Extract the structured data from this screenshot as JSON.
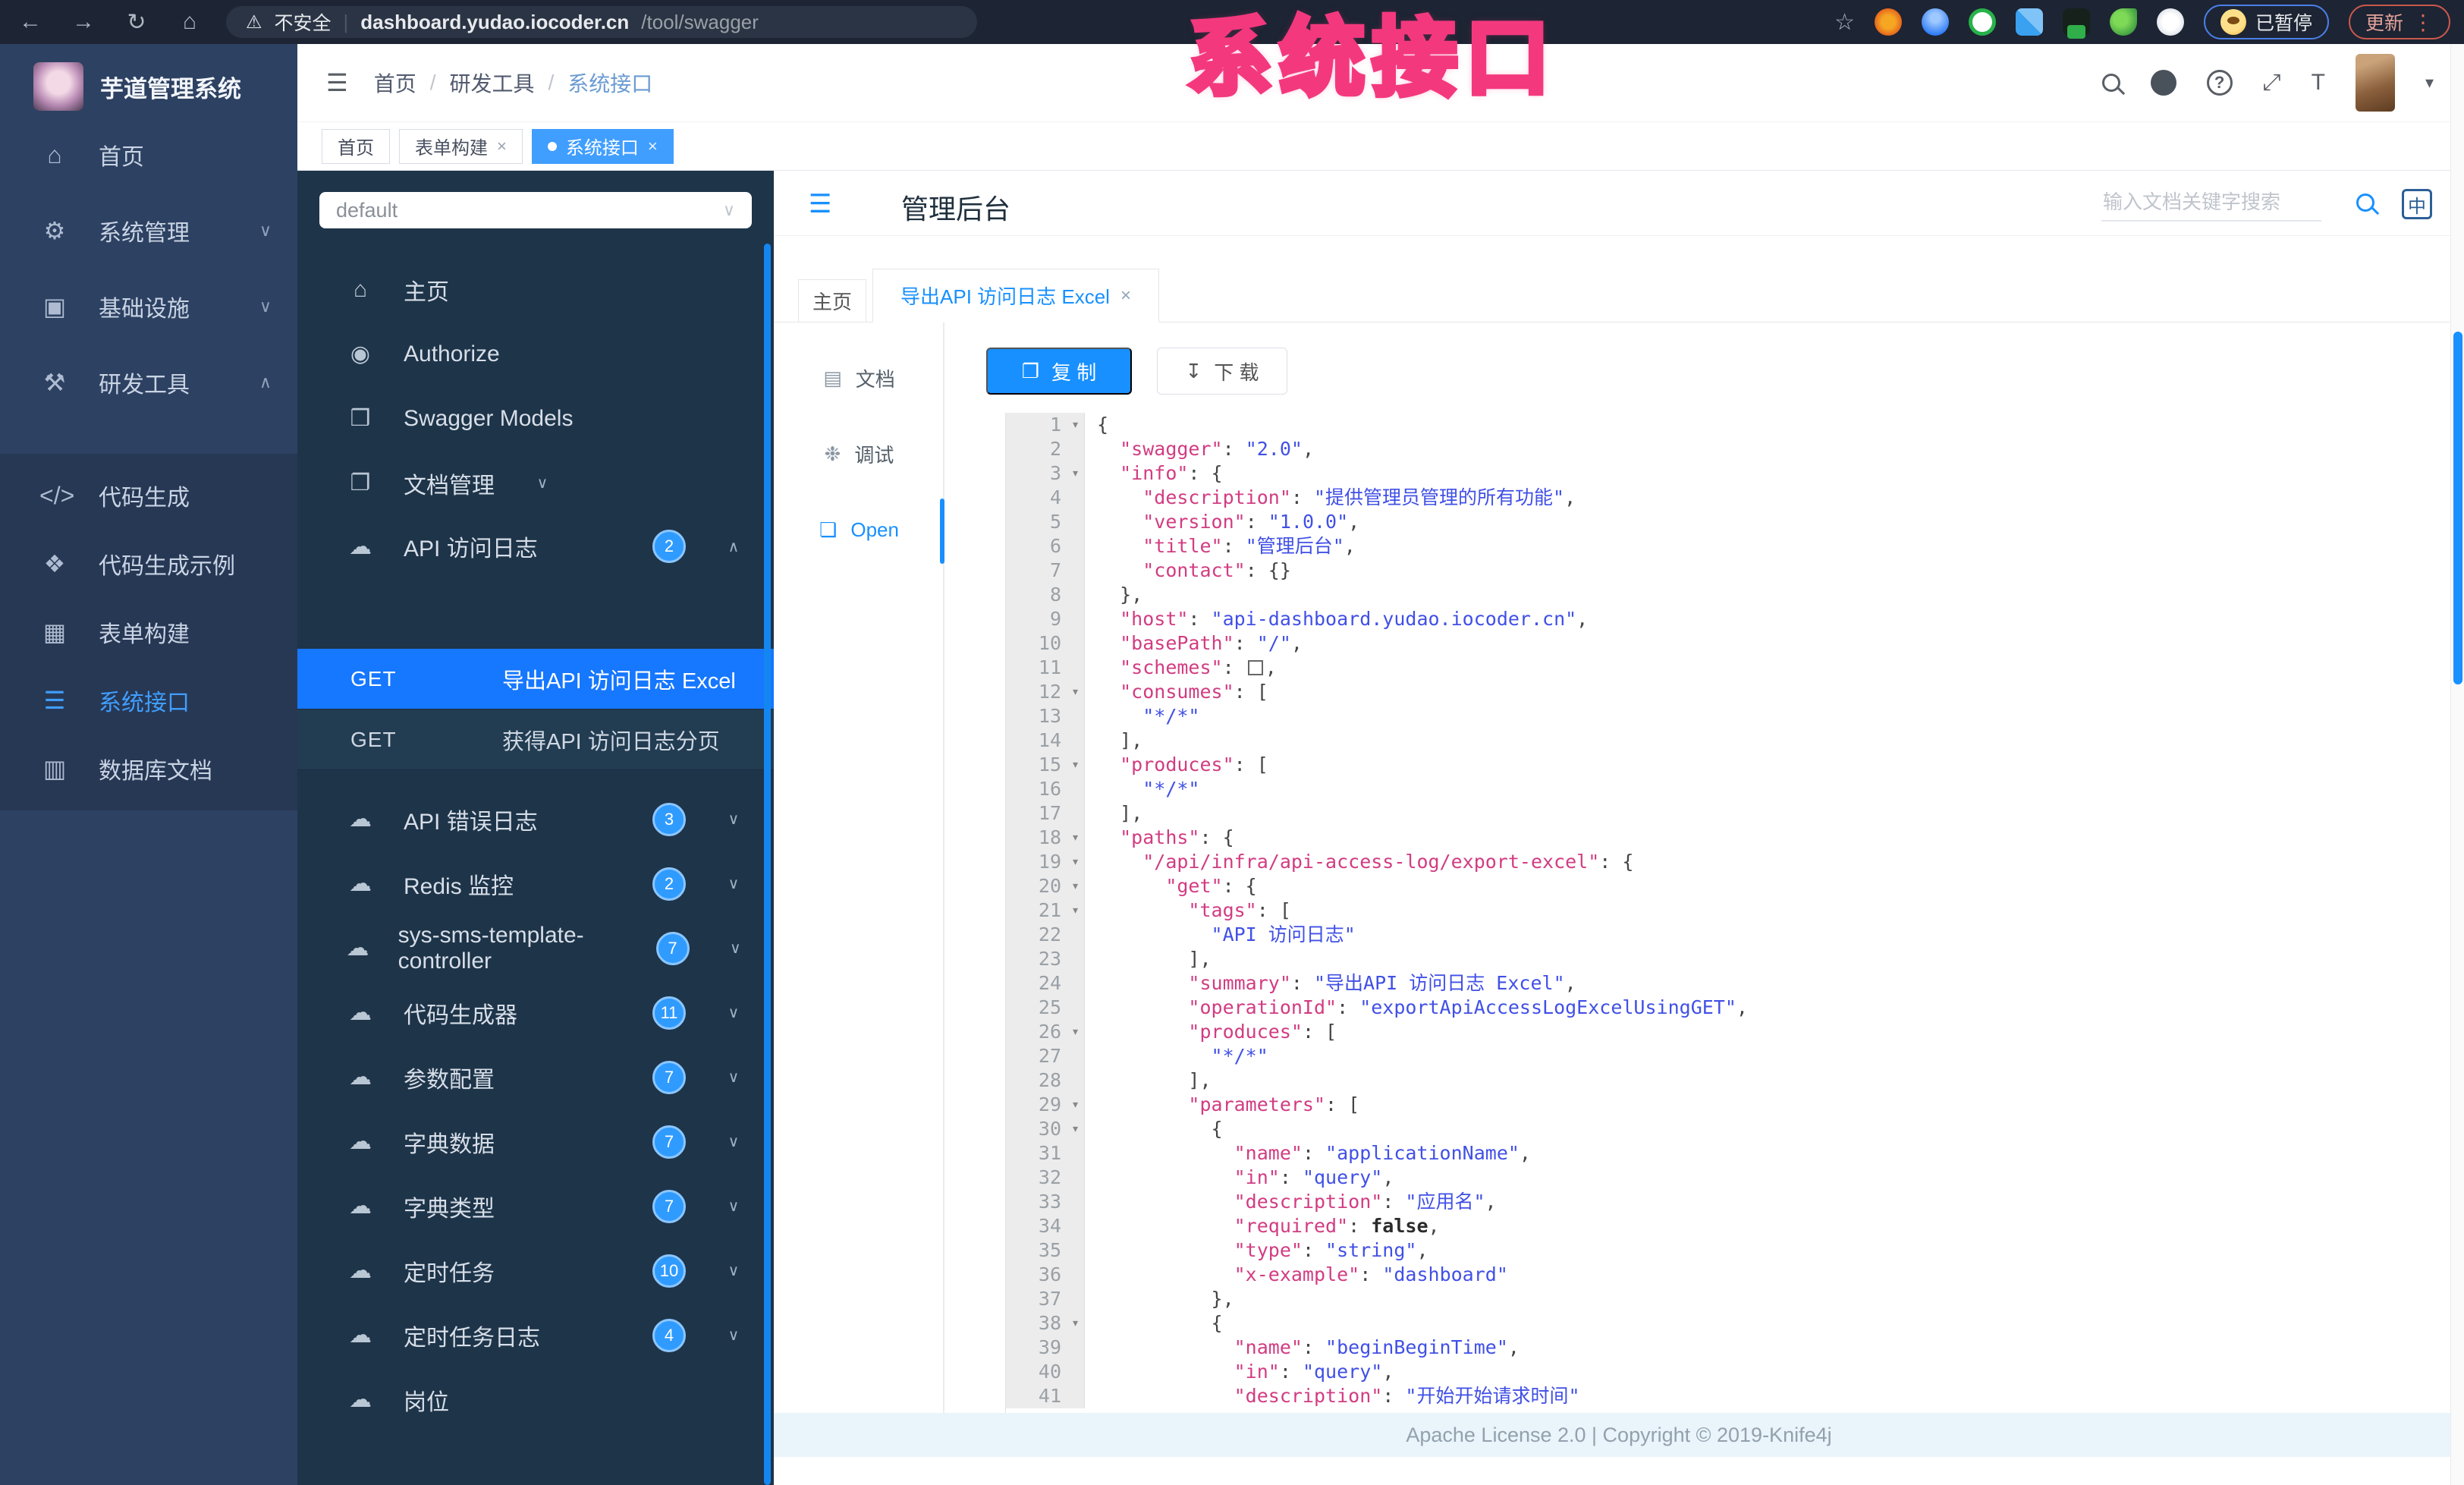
{
  "browser": {
    "security_label": "不安全",
    "url_host": "dashboard.yudao.iocoder.cn",
    "url_path": "/tool/swagger",
    "paused_label": "已暂停",
    "update_label": "更新"
  },
  "annotation": {
    "text": "系统接口"
  },
  "icons": {
    "back": "←",
    "forward": "→",
    "reload": "↻",
    "home": "⌂",
    "warning": "⚠",
    "star": "☆",
    "kebab": "⋮",
    "github": "",
    "help": "?",
    "fullscreen": "⤢",
    "fontsize": "T",
    "caret": "▾",
    "hamburger": "☰",
    "collapse": "☰",
    "divider": "|",
    "lang": "中",
    "copy": "❐",
    "download": "↧",
    "chevron_down": "∨",
    "chevron_up": "∧",
    "close": "×",
    "fold": "▾",
    "select_arrow": "∨"
  },
  "app_sidebar": {
    "logo_title": "芋道管理系统",
    "nav_items": [
      {
        "label": "首页",
        "icon": "⌂",
        "icon_name": "dashboard-icon",
        "arrow": ""
      },
      {
        "label": "系统管理",
        "icon": "⚙",
        "icon_name": "system-gear-icon",
        "arrow": "∨"
      },
      {
        "label": "基础设施",
        "icon": "▣",
        "icon_name": "infrastructure-icon",
        "arrow": "∨"
      },
      {
        "label": "研发工具",
        "icon": "⚒",
        "icon_name": "dev-tools-icon",
        "arrow": "∧"
      }
    ],
    "sub_items": [
      {
        "label": "代码生成",
        "icon": "</>",
        "icon_name": "code-generation-icon",
        "active": false
      },
      {
        "label": "代码生成示例",
        "icon": "❖",
        "icon_name": "code-example-icon",
        "active": false
      },
      {
        "label": "表单构建",
        "icon": "▦",
        "icon_name": "form-builder-icon",
        "active": false
      },
      {
        "label": "系统接口",
        "icon": "☰",
        "icon_name": "system-api-icon",
        "active": true
      },
      {
        "label": "数据库文档",
        "icon": "▥",
        "icon_name": "database-doc-icon",
        "active": false
      }
    ]
  },
  "topbar": {
    "breadcrumb": [
      "首页",
      "研发工具",
      "系统接口"
    ],
    "tags": [
      {
        "label": "首页",
        "closable": false,
        "active": false
      },
      {
        "label": "表单构建",
        "closable": true,
        "active": false
      },
      {
        "label": "系统接口",
        "closable": true,
        "active": true
      }
    ]
  },
  "api_sidebar": {
    "group_select_value": "default",
    "items": [
      {
        "label": "主页",
        "icon": "⌂",
        "icon_name": "home-icon"
      },
      {
        "label": "Authorize",
        "icon": "◉",
        "icon_name": "authorize-lock-icon"
      },
      {
        "label": "Swagger Models",
        "icon": "❒",
        "icon_name": "models-cube-icon"
      },
      {
        "label": "文档管理",
        "icon": "❐",
        "icon_name": "doc-manage-icon",
        "arrow": "∨"
      },
      {
        "label": "API 访问日志",
        "icon": "☁",
        "icon_name": "cloud-api-icon",
        "badge": "2",
        "arrow": "∧",
        "children": [
          {
            "method": "GET",
            "label": "导出API 访问日志 Excel",
            "active": true
          },
          {
            "method": "GET",
            "label": "获得API 访问日志分页",
            "active": false
          }
        ]
      },
      {
        "label": "API 错误日志",
        "icon": "☁",
        "icon_name": "cloud-api-icon",
        "badge": "3",
        "arrow": "∨"
      },
      {
        "label": "Redis 监控",
        "icon": "☁",
        "icon_name": "cloud-api-icon",
        "badge": "2",
        "arrow": "∨"
      },
      {
        "label": "sys-sms-template-controller",
        "icon": "☁",
        "icon_name": "cloud-api-icon",
        "badge": "7",
        "arrow": "∨"
      },
      {
        "label": "代码生成器",
        "icon": "☁",
        "icon_name": "cloud-api-icon",
        "badge": "11",
        "arrow": "∨"
      },
      {
        "label": "参数配置",
        "icon": "☁",
        "icon_name": "cloud-api-icon",
        "badge": "7",
        "arrow": "∨"
      },
      {
        "label": "字典数据",
        "icon": "☁",
        "icon_name": "cloud-api-icon",
        "badge": "7",
        "arrow": "∨"
      },
      {
        "label": "字典类型",
        "icon": "☁",
        "icon_name": "cloud-api-icon",
        "badge": "7",
        "arrow": "∨"
      },
      {
        "label": "定时任务",
        "icon": "☁",
        "icon_name": "cloud-api-icon",
        "badge": "10",
        "arrow": "∨"
      },
      {
        "label": "定时任务日志",
        "icon": "☁",
        "icon_name": "cloud-api-icon",
        "badge": "4",
        "arrow": "∨"
      },
      {
        "label": "岗位",
        "icon": "☁",
        "icon_name": "cloud-api-icon",
        "badge": "",
        "arrow": ""
      }
    ]
  },
  "content": {
    "title": "管理后台",
    "search_placeholder": "输入文档关键字搜索",
    "lang_label": "中",
    "tabs": [
      {
        "label": "主页",
        "closable": false,
        "active": false
      },
      {
        "label": "导出API 访问日志 Excel",
        "closable": true,
        "active": true
      }
    ],
    "rail": [
      {
        "label": "文档",
        "icon": "▤",
        "icon_name": "doc-icon",
        "active": false
      },
      {
        "label": "调试",
        "icon": "❉",
        "icon_name": "bug-debug-icon",
        "active": false
      },
      {
        "label": "Open",
        "icon": "❏",
        "icon_name": "open-file-icon",
        "active": true
      }
    ],
    "copy_label": "复 制",
    "download_label": "下 载",
    "footer": "Apache License 2.0 | Copyright © 2019-Knife4j"
  },
  "code": {
    "lines": [
      {
        "n": 1,
        "f": true,
        "s": [
          [
            "p",
            "{"
          ]
        ]
      },
      {
        "n": 2,
        "s": [
          [
            "p",
            "  "
          ],
          [
            "k",
            "\"swagger\""
          ],
          [
            "p",
            ": "
          ],
          [
            "s",
            "\"2.0\""
          ],
          [
            "p",
            ","
          ]
        ]
      },
      {
        "n": 3,
        "f": true,
        "s": [
          [
            "p",
            "  "
          ],
          [
            "k",
            "\"info\""
          ],
          [
            "p",
            ": {"
          ]
        ]
      },
      {
        "n": 4,
        "s": [
          [
            "p",
            "    "
          ],
          [
            "k",
            "\"description\""
          ],
          [
            "p",
            ": "
          ],
          [
            "s",
            "\"提供管理员管理的所有功能\""
          ],
          [
            "p",
            ","
          ]
        ]
      },
      {
        "n": 5,
        "s": [
          [
            "p",
            "    "
          ],
          [
            "k",
            "\"version\""
          ],
          [
            "p",
            ": "
          ],
          [
            "s",
            "\"1.0.0\""
          ],
          [
            "p",
            ","
          ]
        ]
      },
      {
        "n": 6,
        "s": [
          [
            "p",
            "    "
          ],
          [
            "k",
            "\"title\""
          ],
          [
            "p",
            ": "
          ],
          [
            "s",
            "\"管理后台\""
          ],
          [
            "p",
            ","
          ]
        ]
      },
      {
        "n": 7,
        "s": [
          [
            "p",
            "    "
          ],
          [
            "k",
            "\"contact\""
          ],
          [
            "p",
            ": {}"
          ]
        ]
      },
      {
        "n": 8,
        "s": [
          [
            "p",
            "  },"
          ]
        ]
      },
      {
        "n": 9,
        "s": [
          [
            "p",
            "  "
          ],
          [
            "k",
            "\"host\""
          ],
          [
            "p",
            ": "
          ],
          [
            "s",
            "\"api-dashboard.yudao.iocoder.cn\""
          ],
          [
            "p",
            ","
          ]
        ]
      },
      {
        "n": 10,
        "s": [
          [
            "p",
            "  "
          ],
          [
            "k",
            "\"basePath\""
          ],
          [
            "p",
            ": "
          ],
          [
            "s",
            "\"/\""
          ],
          [
            "p",
            ","
          ]
        ]
      },
      {
        "n": 11,
        "s": [
          [
            "p",
            "  "
          ],
          [
            "k",
            "\"schemes\""
          ],
          [
            "p",
            ": "
          ],
          [
            "x",
            ""
          ],
          [
            "p",
            ","
          ]
        ]
      },
      {
        "n": 12,
        "f": true,
        "s": [
          [
            "p",
            "  "
          ],
          [
            "k",
            "\"consumes\""
          ],
          [
            "p",
            ": ["
          ]
        ]
      },
      {
        "n": 13,
        "s": [
          [
            "p",
            "    "
          ],
          [
            "s",
            "\"*/*\""
          ]
        ]
      },
      {
        "n": 14,
        "s": [
          [
            "p",
            "  ],"
          ]
        ]
      },
      {
        "n": 15,
        "f": true,
        "s": [
          [
            "p",
            "  "
          ],
          [
            "k",
            "\"produces\""
          ],
          [
            "p",
            ": ["
          ]
        ]
      },
      {
        "n": 16,
        "s": [
          [
            "p",
            "    "
          ],
          [
            "s",
            "\"*/*\""
          ]
        ]
      },
      {
        "n": 17,
        "s": [
          [
            "p",
            "  ],"
          ]
        ]
      },
      {
        "n": 18,
        "f": true,
        "s": [
          [
            "p",
            "  "
          ],
          [
            "k",
            "\"paths\""
          ],
          [
            "p",
            ": {"
          ]
        ]
      },
      {
        "n": 19,
        "f": true,
        "s": [
          [
            "p",
            "    "
          ],
          [
            "k",
            "\"/api/infra/api-access-log/export-excel\""
          ],
          [
            "p",
            ": {"
          ]
        ]
      },
      {
        "n": 20,
        "f": true,
        "s": [
          [
            "p",
            "      "
          ],
          [
            "k",
            "\"get\""
          ],
          [
            "p",
            ": {"
          ]
        ]
      },
      {
        "n": 21,
        "f": true,
        "s": [
          [
            "p",
            "        "
          ],
          [
            "k",
            "\"tags\""
          ],
          [
            "p",
            ": ["
          ]
        ]
      },
      {
        "n": 22,
        "s": [
          [
            "p",
            "          "
          ],
          [
            "s",
            "\"API 访问日志\""
          ]
        ]
      },
      {
        "n": 23,
        "s": [
          [
            "p",
            "        ],"
          ]
        ]
      },
      {
        "n": 24,
        "s": [
          [
            "p",
            "        "
          ],
          [
            "k",
            "\"summary\""
          ],
          [
            "p",
            ": "
          ],
          [
            "s",
            "\"导出API 访问日志 Excel\""
          ],
          [
            "p",
            ","
          ]
        ]
      },
      {
        "n": 25,
        "s": [
          [
            "p",
            "        "
          ],
          [
            "k",
            "\"operationId\""
          ],
          [
            "p",
            ": "
          ],
          [
            "s",
            "\"exportApiAccessLogExcelUsingGET\""
          ],
          [
            "p",
            ","
          ]
        ]
      },
      {
        "n": 26,
        "f": true,
        "s": [
          [
            "p",
            "        "
          ],
          [
            "k",
            "\"produces\""
          ],
          [
            "p",
            ": ["
          ]
        ]
      },
      {
        "n": 27,
        "s": [
          [
            "p",
            "          "
          ],
          [
            "s",
            "\"*/*\""
          ]
        ]
      },
      {
        "n": 28,
        "s": [
          [
            "p",
            "        ],"
          ]
        ]
      },
      {
        "n": 29,
        "f": true,
        "s": [
          [
            "p",
            "        "
          ],
          [
            "k",
            "\"parameters\""
          ],
          [
            "p",
            ": ["
          ]
        ]
      },
      {
        "n": 30,
        "f": true,
        "s": [
          [
            "p",
            "          {"
          ]
        ]
      },
      {
        "n": 31,
        "s": [
          [
            "p",
            "            "
          ],
          [
            "k",
            "\"name\""
          ],
          [
            "p",
            ": "
          ],
          [
            "s",
            "\"applicationName\""
          ],
          [
            "p",
            ","
          ]
        ]
      },
      {
        "n": 32,
        "s": [
          [
            "p",
            "            "
          ],
          [
            "k",
            "\"in\""
          ],
          [
            "p",
            ": "
          ],
          [
            "s",
            "\"query\""
          ],
          [
            "p",
            ","
          ]
        ]
      },
      {
        "n": 33,
        "s": [
          [
            "p",
            "            "
          ],
          [
            "k",
            "\"description\""
          ],
          [
            "p",
            ": "
          ],
          [
            "s",
            "\"应用名\""
          ],
          [
            "p",
            ","
          ]
        ]
      },
      {
        "n": 34,
        "s": [
          [
            "p",
            "            "
          ],
          [
            "k",
            "\"required\""
          ],
          [
            "p",
            ": "
          ],
          [
            "b",
            "false"
          ],
          [
            "p",
            ","
          ]
        ]
      },
      {
        "n": 35,
        "s": [
          [
            "p",
            "            "
          ],
          [
            "k",
            "\"type\""
          ],
          [
            "p",
            ": "
          ],
          [
            "s",
            "\"string\""
          ],
          [
            "p",
            ","
          ]
        ]
      },
      {
        "n": 36,
        "s": [
          [
            "p",
            "            "
          ],
          [
            "k",
            "\"x-example\""
          ],
          [
            "p",
            ": "
          ],
          [
            "s",
            "\"dashboard\""
          ]
        ]
      },
      {
        "n": 37,
        "s": [
          [
            "p",
            "          },"
          ]
        ]
      },
      {
        "n": 38,
        "f": true,
        "s": [
          [
            "p",
            "          {"
          ]
        ]
      },
      {
        "n": 39,
        "s": [
          [
            "p",
            "            "
          ],
          [
            "k",
            "\"name\""
          ],
          [
            "p",
            ": "
          ],
          [
            "s",
            "\"beginBeginTime\""
          ],
          [
            "p",
            ","
          ]
        ]
      },
      {
        "n": 40,
        "s": [
          [
            "p",
            "            "
          ],
          [
            "k",
            "\"in\""
          ],
          [
            "p",
            ": "
          ],
          [
            "s",
            "\"query\""
          ],
          [
            "p",
            ","
          ]
        ]
      },
      {
        "n": 41,
        "s": [
          [
            "p",
            "            "
          ],
          [
            "k",
            "\"description\""
          ],
          [
            "p",
            ": "
          ],
          [
            "s",
            "\"开始开始请求时间\""
          ]
        ]
      }
    ]
  }
}
